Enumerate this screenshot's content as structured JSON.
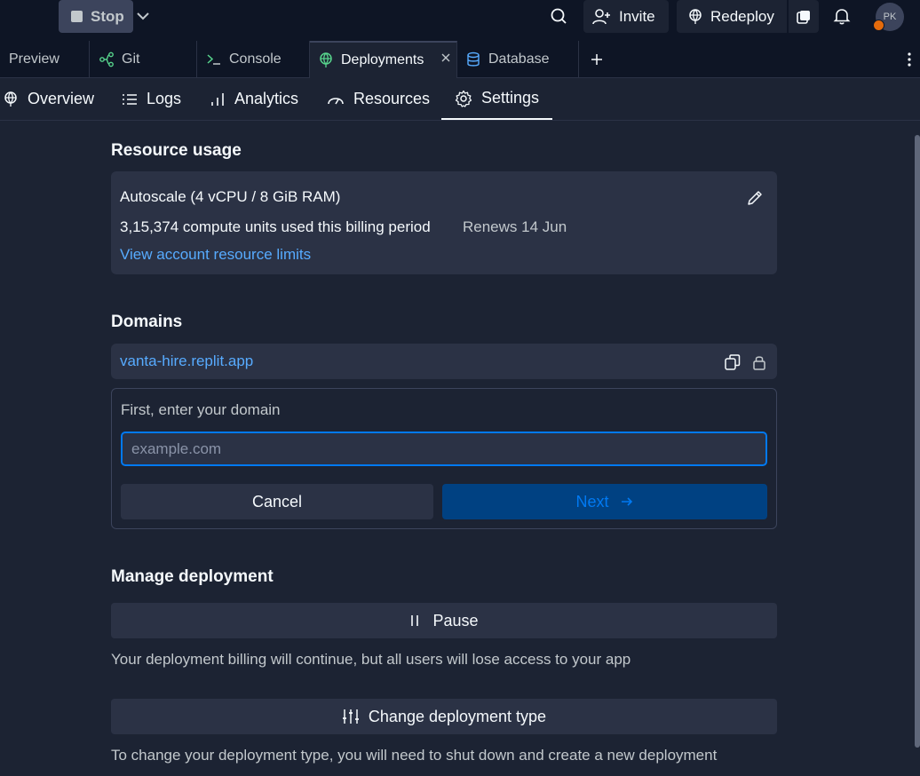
{
  "topbar": {
    "stop_label": "Stop",
    "invite_label": "Invite",
    "redeploy_label": "Redeploy",
    "avatar_initials": "PK"
  },
  "tabs": [
    {
      "label": "Preview",
      "icon": "preview-icon"
    },
    {
      "label": "Git",
      "icon": "git-branch-icon"
    },
    {
      "label": "Console",
      "icon": "terminal-icon"
    },
    {
      "label": "Deployments",
      "icon": "deployments-icon",
      "active": true
    },
    {
      "label": "Database",
      "icon": "database-icon"
    }
  ],
  "subnav": [
    {
      "label": "Overview",
      "icon": "deploy-globe-icon"
    },
    {
      "label": "Logs",
      "icon": "list-icon"
    },
    {
      "label": "Analytics",
      "icon": "bar-chart-icon"
    },
    {
      "label": "Resources",
      "icon": "gauge-icon"
    },
    {
      "label": "Settings",
      "icon": "gear-icon",
      "active": true
    }
  ],
  "resource_usage": {
    "heading": "Resource usage",
    "plan": "Autoscale (4 vCPU / 8 GiB RAM)",
    "usage": "3,15,374 compute units used this billing period",
    "renews": "Renews 14 Jun",
    "limits_link": "View account resource limits"
  },
  "domains": {
    "heading": "Domains",
    "current_domain": "vanta-hire.replit.app",
    "prompt": "First, enter your domain",
    "input_value": "",
    "input_placeholder": "example.com",
    "cancel_label": "Cancel",
    "next_label": "Next"
  },
  "manage": {
    "heading": "Manage deployment",
    "pause_label": "Pause",
    "pause_desc": "Your deployment billing will continue, but all users will lose access to your app",
    "change_label": "Change deployment type",
    "change_desc": "To change your deployment type, you will need to shut down and create a new deployment"
  },
  "colors": {
    "background": "#1c2333",
    "topbar": "#0e1525",
    "card": "#2b3245",
    "link": "#57abff",
    "accent": "#0079f2",
    "primary_button": "#004182"
  }
}
